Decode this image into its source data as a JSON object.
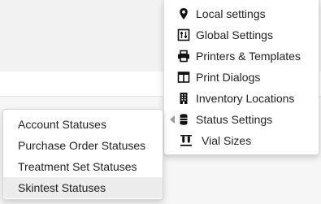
{
  "menu": {
    "items": [
      {
        "label": "Local settings",
        "icon": "map-marker-icon"
      },
      {
        "label": "Global Settings",
        "icon": "sliders-icon"
      },
      {
        "label": "Printers & Templates",
        "icon": "printer-icon"
      },
      {
        "label": "Print Dialogs",
        "icon": "columns-icon"
      },
      {
        "label": "Inventory Locations",
        "icon": "building-icon"
      },
      {
        "label": "Status Settings",
        "icon": "database-icon",
        "has_submenu": true
      },
      {
        "label": "Vial Sizes",
        "icon": "vials-icon"
      }
    ]
  },
  "submenu": {
    "items": [
      {
        "label": "Account Statuses"
      },
      {
        "label": "Purchase Order Statuses"
      },
      {
        "label": "Treatment Set Statuses"
      },
      {
        "label": "Skintest Statuses",
        "active": true
      }
    ]
  },
  "colors": {
    "text": "#222222",
    "icon": "#111111",
    "hover": "#ececec",
    "border": "#d8d8d8"
  }
}
